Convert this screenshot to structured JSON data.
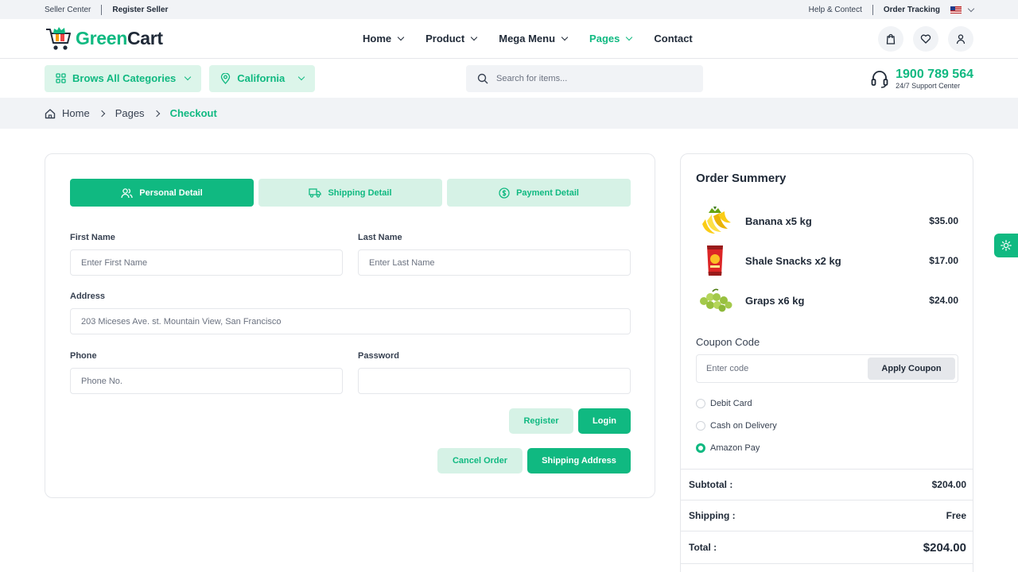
{
  "topbar": {
    "seller_center": "Seller Center",
    "register_seller": "Register Seller",
    "help_contact": "Help & Contect",
    "order_tracking": "Order Tracking"
  },
  "header": {
    "logo_green": "Green",
    "logo_dark": "Cart",
    "nav": [
      {
        "label": "Home"
      },
      {
        "label": "Product"
      },
      {
        "label": "Mega Menu"
      },
      {
        "label": "Pages"
      },
      {
        "label": "Contact"
      }
    ]
  },
  "searchrow": {
    "categories_label": "Brows All Categories",
    "location_label": "California",
    "search_placeholder": "Search for items...",
    "support_number": "1900 789 564",
    "support_sub": "24/7 Support Center"
  },
  "breadcrumb": {
    "items": [
      "Home",
      "Pages",
      "Checkout"
    ]
  },
  "checkout": {
    "tabs": [
      "Personal Detail",
      "Shipping Detail",
      "Payment Detail"
    ],
    "first_name_label": "First Name",
    "first_name_placeholder": "Enter First Name",
    "last_name_label": "Last Name",
    "last_name_placeholder": "Enter Last Name",
    "address_label": "Address",
    "address_value": "203 Miceses Ave. st. Mountain View, San Francisco",
    "phone_label": "Phone",
    "phone_placeholder": "Phone No.",
    "password_label": "Password",
    "register": "Register",
    "login": "Login",
    "cancel_order": "Cancel Order",
    "shipping_address": "Shipping Address"
  },
  "summary": {
    "title": "Order Summery",
    "items": [
      {
        "name": "Banana x5 kg",
        "price": "$35.00"
      },
      {
        "name": "Shale Snacks x2 kg",
        "price": "$17.00"
      },
      {
        "name": "Graps x6 kg",
        "price": "$24.00"
      }
    ],
    "coupon_label": "Coupon Code",
    "coupon_placeholder": "Enter code",
    "apply_coupon": "Apply Coupon",
    "payment_options": [
      "Debit Card",
      "Cash on Delivery",
      "Amazon Pay"
    ],
    "selected_payment": "Amazon Pay",
    "subtotal_label": "Subtotal :",
    "subtotal_value": "$204.00",
    "shipping_label": "Shipping :",
    "shipping_value": "Free",
    "total_label": "Total :",
    "total_value": "$204.00"
  },
  "colors": {
    "accent": "#10b981",
    "accent_light": "#d6f2e6"
  }
}
